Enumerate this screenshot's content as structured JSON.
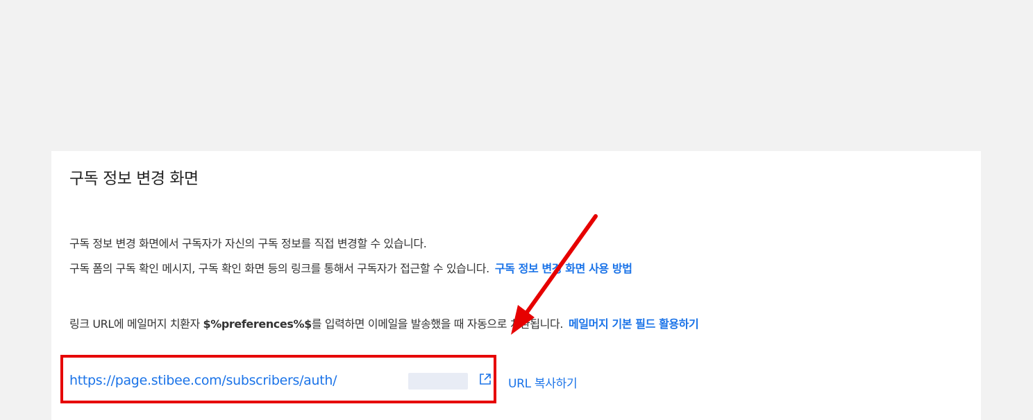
{
  "section": {
    "title": "구독 정보 변경 화면",
    "description_line_1": "구독 정보 변경 화면에서 구독자가 자신의 구독 정보를 직접 변경할 수 있습니다.",
    "description_line_2": "구독 폼의 구독 확인 메시지, 구독 확인 화면 등의 링크를 통해서 구독자가 접근할 수 있습니다.",
    "usage_link_label": "구독 정보 변경 화면 사용 방법",
    "substitution_prefix": "링크 URL에 메일머지 치환자 ",
    "substitution_code": "$%preferences%$",
    "substitution_suffix": "를 입력하면 이메일을 발송했을 때 자동으로 치환됩니다.",
    "mailmerge_link_label": "메일머지 기본 필드 활용하기"
  },
  "url_row": {
    "url": "https://page.stibee.com/subscribers/auth/",
    "copy_label": "URL 복사하기",
    "external_icon": "external-link-icon"
  },
  "annotation": {
    "arrow_color": "#e60000",
    "box_color": "#e60000"
  },
  "colors": {
    "link": "#1a73e8",
    "text": "#333333",
    "background": "#f2f2f2",
    "card": "#ffffff"
  }
}
